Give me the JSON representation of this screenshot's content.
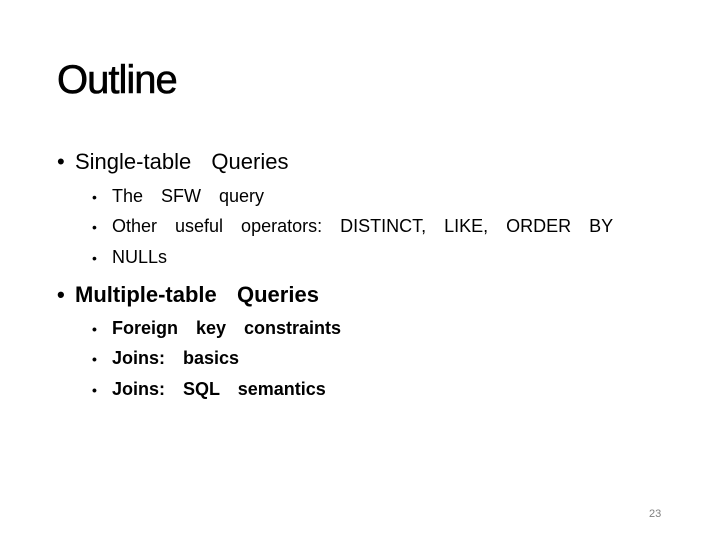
{
  "slide": {
    "title": "Outline",
    "sections": [
      {
        "label": "Single-table  Queries",
        "bold": false,
        "items": [
          "The  SFW  query",
          "Other  useful  operators:  DISTINCT,  LIKE,  ORDER  BY",
          "NULLs"
        ]
      },
      {
        "label": "Multiple-table  Queries",
        "bold": true,
        "items": [
          "Foreign  key  constraints",
          "Joins:  basics",
          "Joins:  SQL  semantics"
        ]
      }
    ],
    "bullet_glyph": "•",
    "page_number": "23"
  }
}
